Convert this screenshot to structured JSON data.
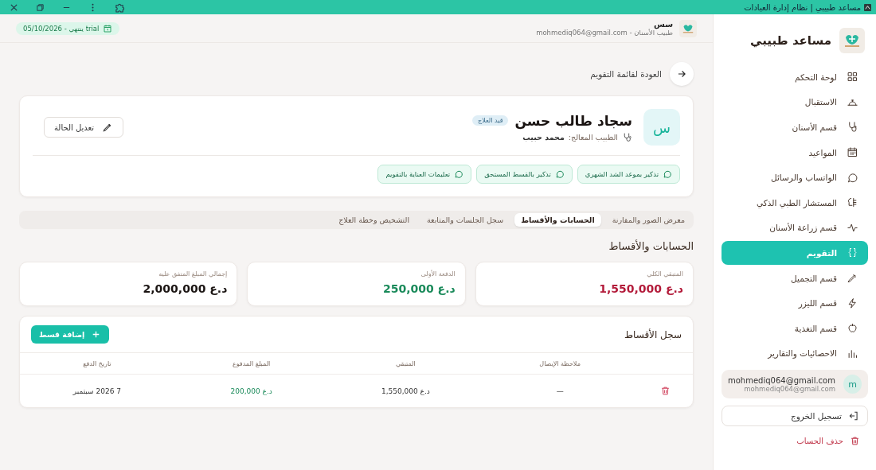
{
  "window": {
    "title": "مساعد طبيبي | نظام إدارة العيادات"
  },
  "header": {
    "user_name": "سس",
    "user_role": "طبيب الأسنان - mohmediq064@gmail.com",
    "trial_badge": "trial ينتهي - 05/10/2026"
  },
  "sidebar": {
    "app_name": "مساعد طبيبي",
    "items": [
      {
        "label": "لوحة التحكم",
        "selected": false
      },
      {
        "label": "الاستقبال",
        "selected": false
      },
      {
        "label": "قسم الأسنان",
        "selected": false
      },
      {
        "label": "المواعيد",
        "selected": false
      },
      {
        "label": "الواتساب والرسائل",
        "selected": false
      },
      {
        "label": "المستشار الطبي الذكي",
        "selected": false
      },
      {
        "label": "قسم زراعة الأسنان",
        "selected": false
      },
      {
        "label": "التقويم",
        "selected": true
      },
      {
        "label": "قسم التجميل",
        "selected": false
      },
      {
        "label": "قسم الليزر",
        "selected": false
      },
      {
        "label": "قسم التغذية",
        "selected": false
      },
      {
        "label": "الاحصائيات والتقارير",
        "selected": false
      }
    ],
    "account": {
      "avatar": "m",
      "name": "mohmediq064@gmail.com",
      "email": "mohmediq064@gmail.com"
    },
    "logout": "تسجيل الخروج",
    "delete_account": "حذف الحساب"
  },
  "back_link": "العودة لقائمة التقويم",
  "patient": {
    "avatar": "س",
    "name": "سجاد طالب حسن",
    "status": "قيد العلاج",
    "doctor_label": "الطبيب المعالج:",
    "doctor": "محمد حبيب",
    "edit_button": "تعديل الحالة",
    "actions": [
      "تذكير بموعد الشد الشهري",
      "تذكير بالقسط المستحق",
      "تعليمات العناية بالتقويم"
    ]
  },
  "tabs": [
    {
      "label": "معرض الصور والمقارنة",
      "selected": false
    },
    {
      "label": "الحسابات والأقساط",
      "selected": true
    },
    {
      "label": "سجل الجلسات والمتابعة",
      "selected": false
    },
    {
      "label": "التشخيص وخطة العلاج",
      "selected": false
    }
  ],
  "section_title": "الحسابات والأقساط",
  "summary": [
    {
      "label": "المتبقي الكلي",
      "value": "د.ع 1,550,000",
      "color": "#b31b3a"
    },
    {
      "label": "الدفعة الأولى",
      "value": "د.ع 250,000",
      "color": "#1a8a5a"
    },
    {
      "label": "إجمالي المبلغ المتفق عليه",
      "value": "د.ع 2,000,000",
      "color": "#1a1412"
    }
  ],
  "installments": {
    "title": "سجل الأقساط",
    "add_button": "إضافة قسط",
    "columns": [
      "ملاحظة الإيصال",
      "المتبقي",
      "المبلغ المدفوع",
      "تاريخ الدفع"
    ],
    "rows": [
      {
        "note": "—",
        "remaining": "د.ع 1,550,000",
        "paid": "د.ع 200,000",
        "date": "7 2026 سبتمبر"
      }
    ]
  }
}
